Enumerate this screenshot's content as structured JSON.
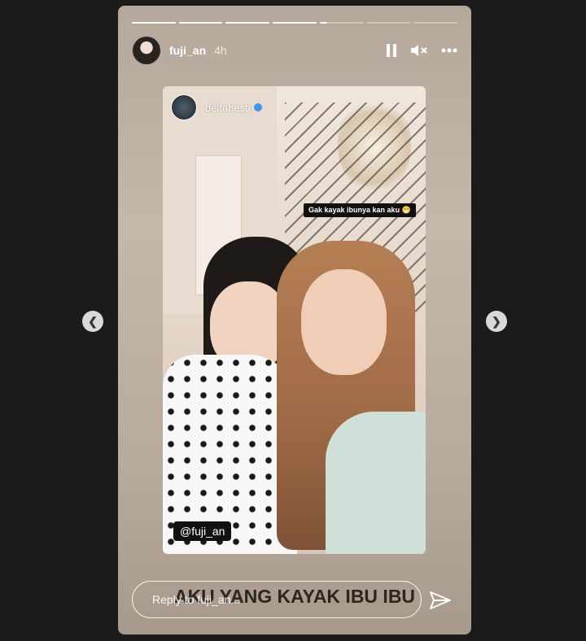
{
  "progress": [
    1,
    1,
    1,
    1,
    0.15,
    0,
    0
  ],
  "header": {
    "username": "fuji_an",
    "time": "4h",
    "icons": [
      "pause-icon",
      "mute-icon",
      "more-icon"
    ]
  },
  "story": {
    "repost_username": "deltahesti",
    "caption_sticker": "Gak kayak ibunya kan aku 😁",
    "mention": "@fuji_an",
    "big_caption": "AKU YANG KAYAK IBU IBU"
  },
  "reply": {
    "placeholder": "Reply to fuji_an..."
  },
  "nav": {
    "prev_icon": "chevron-left-icon",
    "next_icon": "chevron-right-icon"
  },
  "colors": {
    "background": "#1b1b1b",
    "verified": "#3897f0"
  }
}
